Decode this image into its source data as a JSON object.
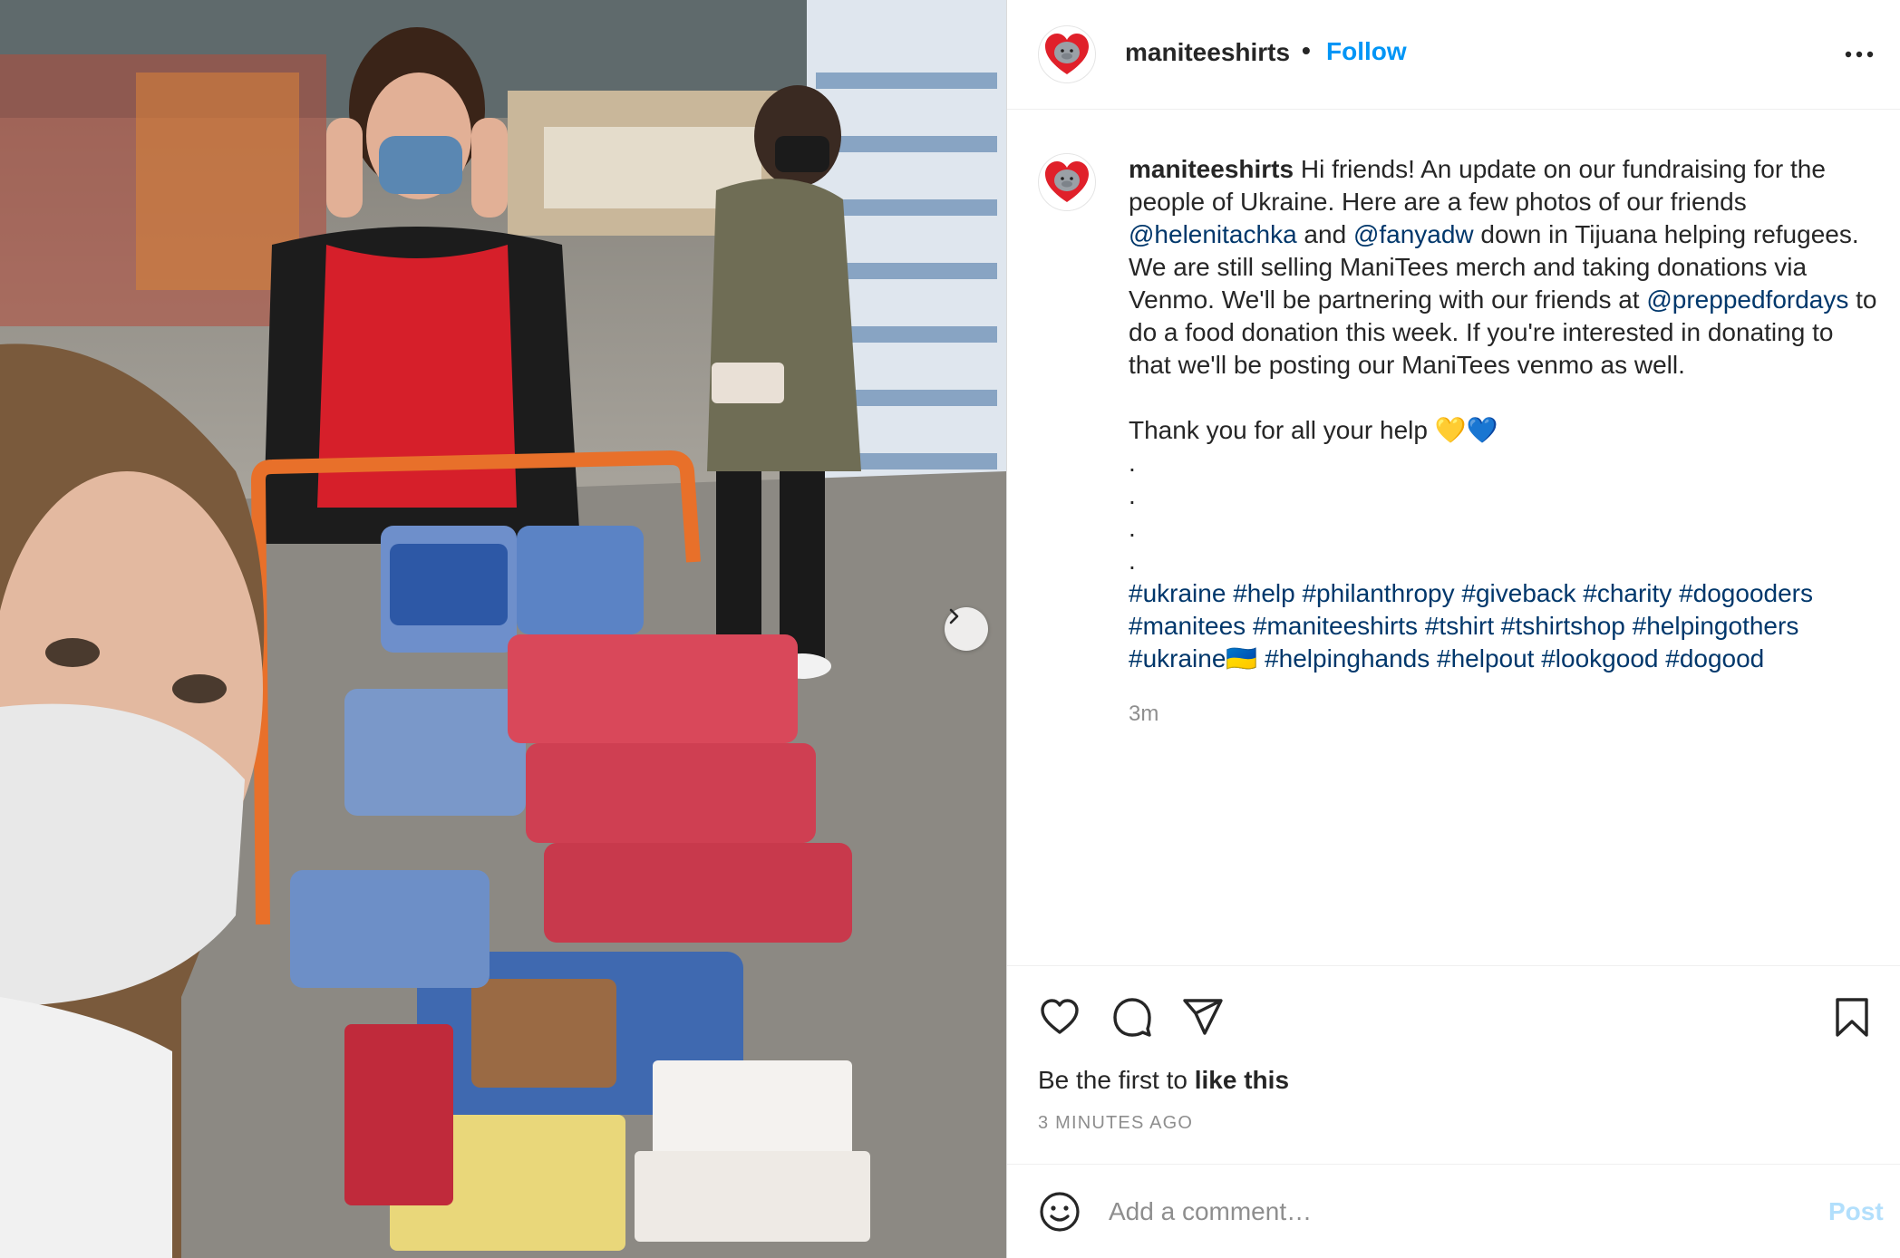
{
  "post": {
    "image_alt": "Photo of volunteers with a cart of bread and food donations in a warehouse store"
  },
  "header": {
    "username": "maniteeshirts",
    "separator": "•",
    "follow_label": "Follow",
    "more_icon": "more-horizontal-icon"
  },
  "caption": {
    "username": "maniteeshirts",
    "parts": [
      {
        "text": " Hi friends! An update on our fundraising for the people of Ukraine. Here are a few photos of our friends ",
        "type": "text"
      },
      {
        "text": "@helenitachka",
        "type": "mention"
      },
      {
        "text": " and ",
        "type": "text"
      },
      {
        "text": "@fanyadw",
        "type": "mention"
      },
      {
        "text": " down in Tijuana helping refugees. We are still selling ManiTees merch and taking donations via Venmo. We'll be partnering with our friends at ",
        "type": "text"
      },
      {
        "text": "@preppedfordays",
        "type": "mention"
      },
      {
        "text": " to do a food donation this week. If you're interested in donating to that we'll be posting our ManiTees venmo as well.\n\nThank you for all your help 💛💙\n.\n.\n.\n.\n",
        "type": "text"
      },
      {
        "text": "#ukraine",
        "type": "hashtag"
      },
      {
        "text": " ",
        "type": "text"
      },
      {
        "text": "#help",
        "type": "hashtag"
      },
      {
        "text": " ",
        "type": "text"
      },
      {
        "text": "#philanthropy",
        "type": "hashtag"
      },
      {
        "text": " ",
        "type": "text"
      },
      {
        "text": "#giveback",
        "type": "hashtag"
      },
      {
        "text": " ",
        "type": "text"
      },
      {
        "text": "#charity",
        "type": "hashtag"
      },
      {
        "text": " ",
        "type": "text"
      },
      {
        "text": "#dogooders",
        "type": "hashtag"
      },
      {
        "text": "\n",
        "type": "text"
      },
      {
        "text": "#manitees",
        "type": "hashtag"
      },
      {
        "text": " ",
        "type": "text"
      },
      {
        "text": "#maniteeshirts",
        "type": "hashtag"
      },
      {
        "text": " ",
        "type": "text"
      },
      {
        "text": "#tshirt",
        "type": "hashtag"
      },
      {
        "text": " ",
        "type": "text"
      },
      {
        "text": "#tshirtshop",
        "type": "hashtag"
      },
      {
        "text": " ",
        "type": "text"
      },
      {
        "text": "#helpingothers",
        "type": "hashtag"
      },
      {
        "text": "\n",
        "type": "text"
      },
      {
        "text": "#ukraine🇺🇦",
        "type": "hashtag"
      },
      {
        "text": " ",
        "type": "text"
      },
      {
        "text": "#helpinghands",
        "type": "hashtag"
      },
      {
        "text": " ",
        "type": "text"
      },
      {
        "text": "#helpout",
        "type": "hashtag"
      },
      {
        "text": " ",
        "type": "text"
      },
      {
        "text": "#lookgood",
        "type": "hashtag"
      },
      {
        "text": " ",
        "type": "text"
      },
      {
        "text": "#dogood",
        "type": "hashtag"
      }
    ],
    "timestamp": "3m"
  },
  "actions": {
    "like_icon": "heart-icon",
    "comment_icon": "comment-icon",
    "share_icon": "share-icon",
    "save_icon": "bookmark-icon",
    "likes_prefix": "Be the first to ",
    "likes_bold": "like this",
    "time_ago": "3 MINUTES AGO"
  },
  "comment": {
    "emoji_icon": "emoji-icon",
    "placeholder": "Add a comment…",
    "post_label": "Post"
  },
  "colors": {
    "accent": "#0095f6",
    "link": "#00376b",
    "post_disabled": "#b2dffc",
    "muted": "#8e8e8e",
    "logo_heart": "#e0202a"
  }
}
